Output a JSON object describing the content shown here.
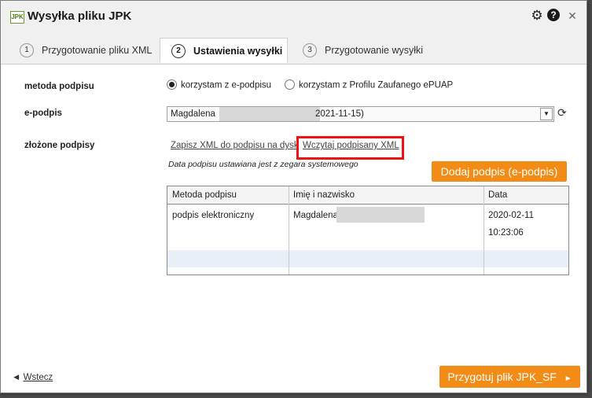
{
  "window": {
    "title": "Wysyłka pliku JPK",
    "logo_text": "JPK",
    "icons": {
      "settings": "gear-icon",
      "help": "help-icon",
      "close": "close-icon"
    },
    "help_glyph": "?",
    "close_glyph": "✕"
  },
  "tabs": [
    {
      "num": "1",
      "label": "Przygotowanie pliku XML"
    },
    {
      "num": "2",
      "label": "Ustawienia wysyłki"
    },
    {
      "num": "3",
      "label": "Przygotowanie wysyłki"
    }
  ],
  "form": {
    "signature_method": {
      "label": "metoda podpisu",
      "option_esign": "korzystam z e-podpisu",
      "option_epuap": "korzystam z Profilu Zaufanego ePUAP"
    },
    "esign": {
      "label": "e-podpis",
      "selected_name": "Magdalena",
      "selected_date": "2021-11-15)"
    },
    "signatures": {
      "label": "złożone podpisy",
      "save_link": "Zapisz XML do podpisu na dysk",
      "load_link": "Wczytaj podpisany XML",
      "note": "Data podpisu ustawiana jest z zegara systemowego",
      "add_button": "Dodaj podpis (e-podpis)"
    }
  },
  "table": {
    "headers": [
      "Metoda podpisu",
      "Imię i nazwisko",
      "Data"
    ],
    "rows": [
      {
        "method": "podpis elektroniczny",
        "name": "Magdalena",
        "date": "2020-02-11 10:23:06"
      }
    ]
  },
  "footer": {
    "back_link": "Wstecz",
    "next_button": "Przygotuj plik JPK_SF",
    "next_arrow": "►",
    "back_arrow": "◄"
  },
  "colors": {
    "accent": "#f28c16",
    "highlight": "#e11111",
    "titlebar": "#f0f0f0"
  }
}
